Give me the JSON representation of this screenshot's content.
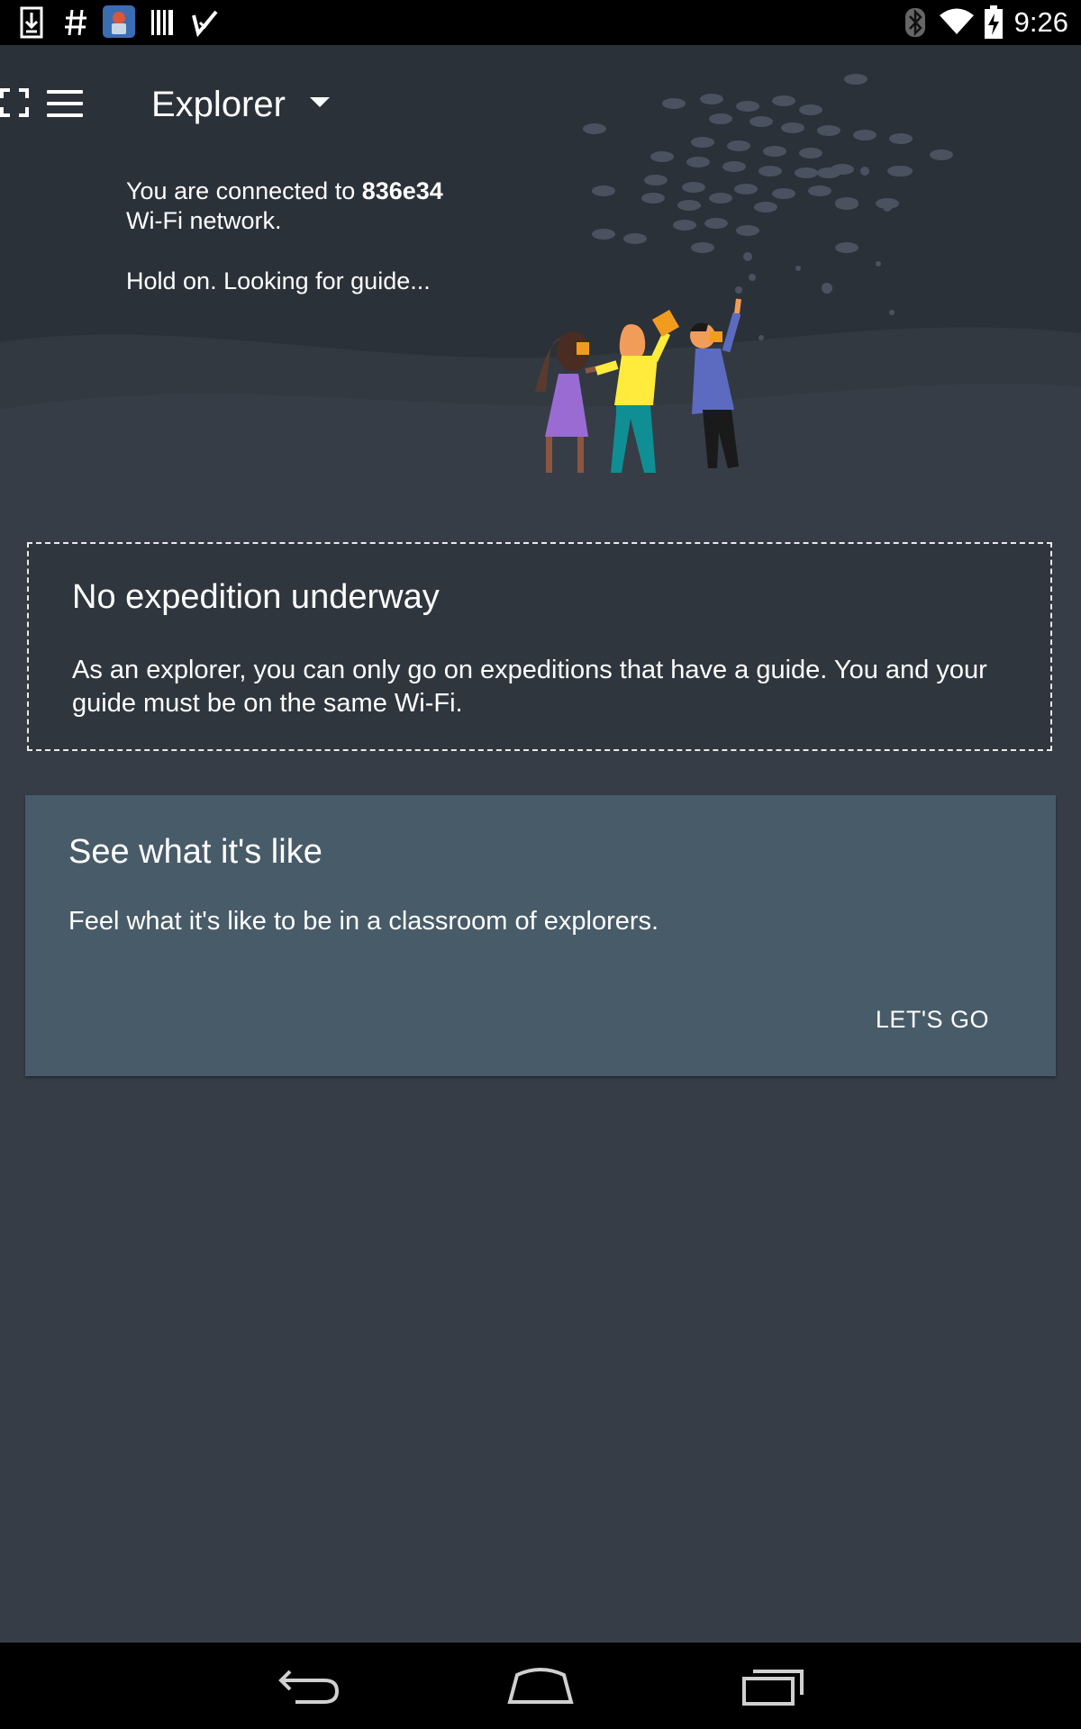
{
  "status_bar": {
    "time": "9:26",
    "left_icons": [
      "download-icon",
      "hash-icon",
      "app-icon",
      "barcode-icon",
      "check-icon"
    ],
    "right_icons": [
      "bluetooth-icon",
      "wifi-icon",
      "battery-icon"
    ]
  },
  "header": {
    "title": "Explorer",
    "menu_icon": "menu-icon",
    "dropdown_icon": "dropdown-arrow-icon",
    "fullscreen_icon": "fullscreen-icon"
  },
  "connection": {
    "prefix": "You are connected to ",
    "network_name": "836e34",
    "suffix": "Wi-Fi network.",
    "status": "Hold on. Looking for guide..."
  },
  "no_expedition_card": {
    "title": "No expedition underway",
    "body": "As an explorer, you can only go on expeditions that have a guide. You and your guide must be on the same Wi-Fi."
  },
  "see_what_card": {
    "title": "See what it's like",
    "body": "Feel what it's like to be in a classroom of explorers.",
    "action_label": "LET'S GO"
  },
  "nav_bar": {
    "icons": [
      "back-icon",
      "home-icon",
      "recents-icon"
    ]
  },
  "colors": {
    "background": "#363d46",
    "hero_background": "#2b3139",
    "card_solid": "#485b69",
    "status_bar": "#000000"
  }
}
